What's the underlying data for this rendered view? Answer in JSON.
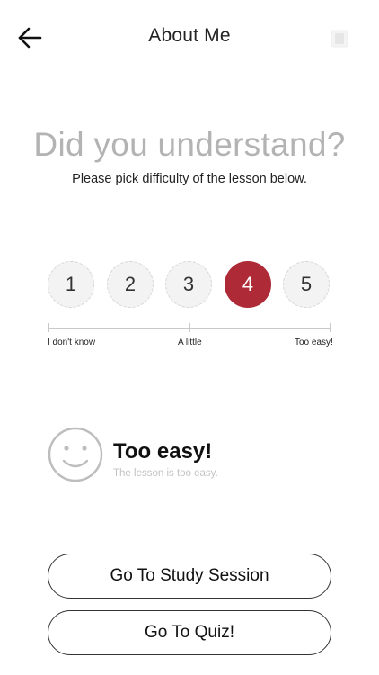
{
  "header": {
    "title": "About Me",
    "back_icon": "arrow-left-icon",
    "right_icon": "book-icon"
  },
  "question": {
    "title": "Did you understand?",
    "subtitle": "Please pick difficulty of the lesson below."
  },
  "rating": {
    "options": [
      "1",
      "2",
      "3",
      "4",
      "5"
    ],
    "selected": "4",
    "selected_color": "#ad2a36",
    "scale_labels": {
      "left": "I don't know",
      "middle": "A little",
      "right": "Too easy!"
    }
  },
  "result": {
    "icon": "smiley-face-icon",
    "title": "Too easy!",
    "description": "The lesson is too easy."
  },
  "actions": {
    "study_label": "Go To Study Session",
    "quiz_label": "Go To Quiz!"
  }
}
